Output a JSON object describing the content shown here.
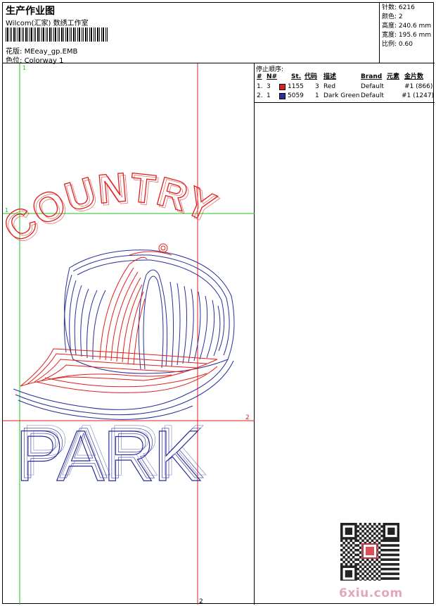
{
  "header": {
    "title": "生产作业图",
    "company": "Wilcom(汇家) 数绣工作室",
    "design_label": "花版:",
    "design_name": "MEeay_gp.EMB",
    "colorway_label": "色位:",
    "colorway_name": "Colorway 1"
  },
  "stats": [
    {
      "label": "针数:",
      "value": "6216"
    },
    {
      "label": "颜色:",
      "value": "2"
    },
    {
      "label": "高度:",
      "value": "240.6 mm"
    },
    {
      "label": "宽度:",
      "value": "195.6 mm"
    },
    {
      "label": "比例:",
      "value": "0.60"
    }
  ],
  "stop_sequence": {
    "title": "停止顺序:",
    "columns": [
      "#",
      "N#",
      "St.",
      "代码",
      "描述",
      "Brand",
      "元素",
      "金片数"
    ],
    "rows": [
      {
        "num": "1.",
        "needle": "3",
        "stitches": "1155",
        "code": "3",
        "desc": "Red",
        "brand": "Default",
        "element": "#1 (866)",
        "color": "#e0201c"
      },
      {
        "num": "2.",
        "needle": "1",
        "stitches": "5059",
        "code": "1",
        "desc": "Dark Green",
        "brand": "Default",
        "element": "#1 (1247)",
        "color": "#2b2f9a"
      }
    ]
  },
  "guides": {
    "v1": "1",
    "h1": "1",
    "h2": "2",
    "v2": "2"
  },
  "design_text": {
    "top": "COUNTRY",
    "bottom": "PARK"
  },
  "colors": {
    "red": "#e0201c",
    "blue": "#2b2f9a",
    "green": "#1ec81e"
  },
  "watermark": "6xiu.com"
}
